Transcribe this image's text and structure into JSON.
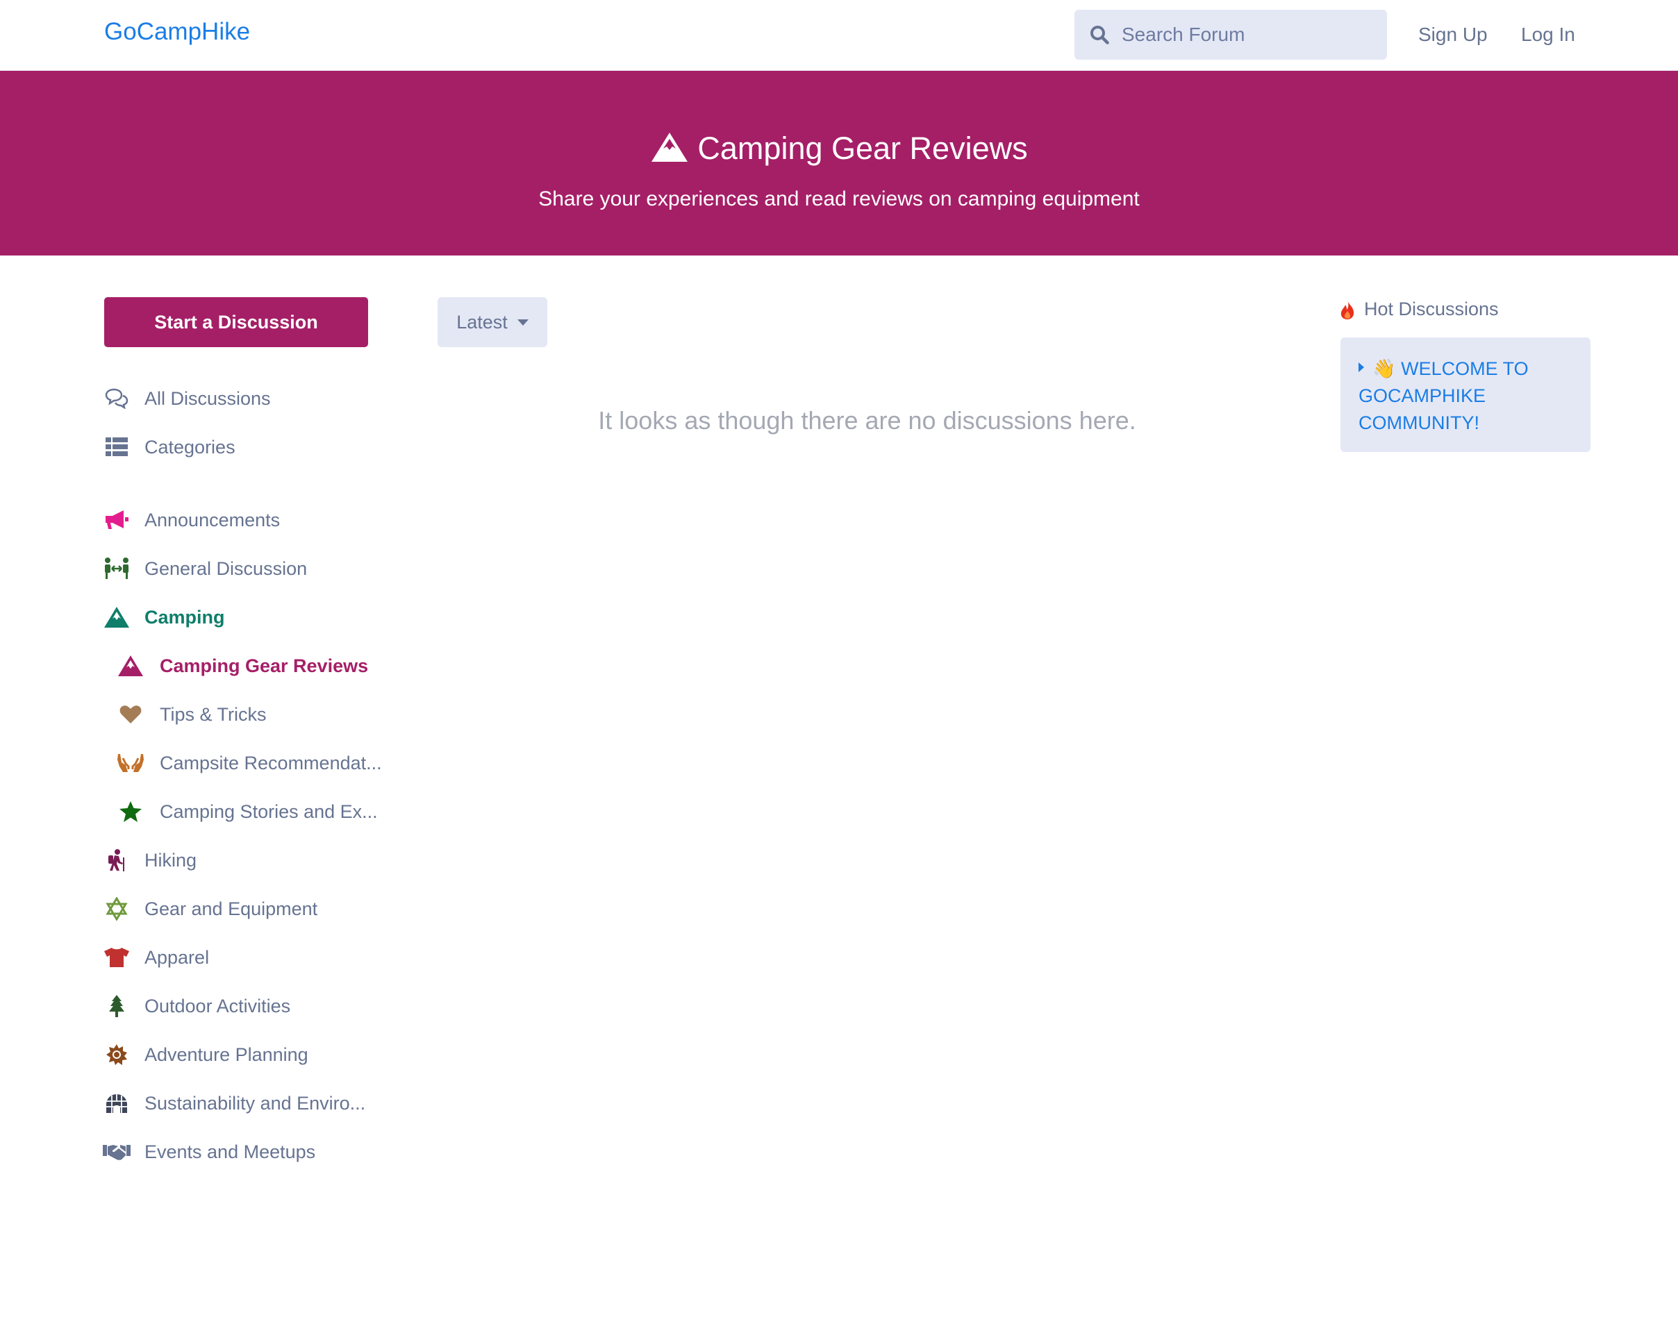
{
  "header": {
    "logo": "GoCampHike",
    "search_placeholder": "Search Forum",
    "signup": "Sign Up",
    "login": "Log In"
  },
  "hero": {
    "title": "Camping Gear Reviews",
    "subtitle": "Share your experiences and read reviews on camping equipment",
    "icon": "mountain-icon"
  },
  "sidebar": {
    "start_button": "Start a Discussion",
    "nav": [
      {
        "label": "All Discussions",
        "icon": "comments-icon"
      },
      {
        "label": "Categories",
        "icon": "list-icon"
      }
    ],
    "tags": [
      {
        "label": "Announcements",
        "icon": "bullhorn-icon",
        "color": "#e41d8e"
      },
      {
        "label": "General Discussion",
        "icon": "people-arrows-icon",
        "color": "#2e6a2e"
      },
      {
        "label": "Camping",
        "icon": "mountain-icon",
        "color": "#0f7e6b"
      },
      {
        "label": "Camping Gear Reviews",
        "icon": "mountain-icon",
        "color": "#a51f67"
      },
      {
        "label": "Tips & Tricks",
        "icon": "heart-icon",
        "color": "#a47d57"
      },
      {
        "label": "Campsite Recommendat...",
        "icon": "hands-icon",
        "color": "#c2702a"
      },
      {
        "label": "Camping Stories and Ex...",
        "icon": "star-icon",
        "color": "#0f6b0f"
      },
      {
        "label": "Hiking",
        "icon": "hiking-icon",
        "color": "#7a1d54"
      },
      {
        "label": "Gear and Equipment",
        "icon": "star-of-david-icon",
        "color": "#6f9a3e"
      },
      {
        "label": "Apparel",
        "icon": "tshirt-icon",
        "color": "#c0312f"
      },
      {
        "label": "Outdoor Activities",
        "icon": "tree-icon",
        "color": "#2d5a2d"
      },
      {
        "label": "Adventure Planning",
        "icon": "sun-icon",
        "color": "#8a4a1d"
      },
      {
        "label": "Sustainability and Enviro...",
        "icon": "igloo-icon",
        "color": "#3e4557"
      },
      {
        "label": "Events and Meetups",
        "icon": "handshake-icon",
        "color": "#667391"
      }
    ]
  },
  "main": {
    "sort_label": "Latest",
    "empty_text": "It looks as though there are no discussions here."
  },
  "aside": {
    "hot_title": "Hot Discussions",
    "hot_items": [
      "👋 WELCOME TO GOCAMPHIKE COMMUNITY!"
    ]
  },
  "colors": {
    "brand": "#a51f67",
    "link": "#1a7de6",
    "text": "#667391",
    "panel": "#e4e8f5"
  }
}
